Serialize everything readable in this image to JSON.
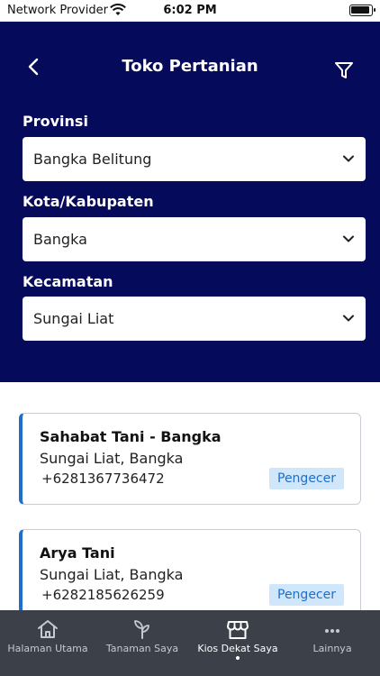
{
  "status_bar": {
    "carrier": "Network Provider",
    "time": "6:02 PM"
  },
  "header": {
    "title": "Toko Pertanian",
    "back_icon": "chevron-left-icon",
    "filter_icon": "filter-icon"
  },
  "filters": {
    "province": {
      "label": "Provinsi",
      "value": "Bangka Belitung"
    },
    "city": {
      "label": "Kota/Kabupaten",
      "value": "Bangka"
    },
    "district": {
      "label": "Kecamatan",
      "value": "Sungai Liat"
    }
  },
  "stores": [
    {
      "name": "Sahabat Tani - Bangka",
      "location": "Sungai Liat, Bangka",
      "phone": "+6281367736472",
      "type": "Pengecer"
    },
    {
      "name": "Arya Tani",
      "location": "Sungai Liat, Bangka",
      "phone": "+6282185626259",
      "type": "Pengecer"
    }
  ],
  "tabbar": {
    "items": [
      {
        "label": "Halaman Utama",
        "icon": "home-icon"
      },
      {
        "label": "Tanaman Saya",
        "icon": "sprout-icon"
      },
      {
        "label": "Kios Dekat Saya",
        "icon": "store-icon",
        "active": true
      },
      {
        "label": "Lainnya",
        "icon": "more-icon"
      }
    ]
  },
  "colors": {
    "header_bg": "#050a5a",
    "accent": "#1f6fc9",
    "badge_bg": "#cfe6fb",
    "tabbar_bg": "#3b4049"
  }
}
